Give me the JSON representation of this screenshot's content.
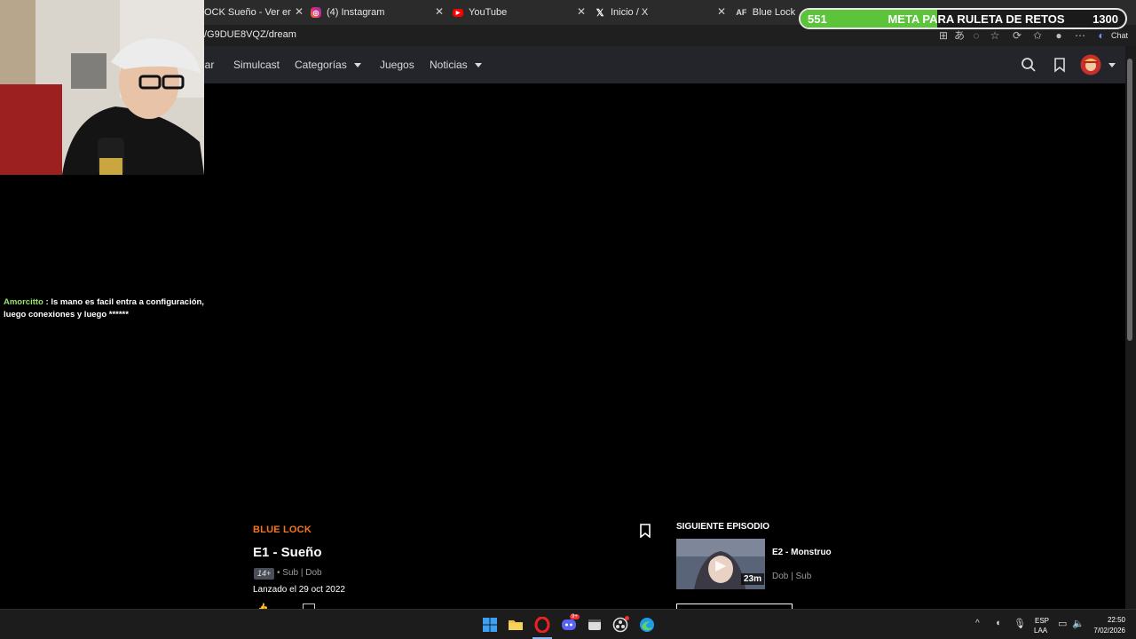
{
  "browser": {
    "tabs": [
      {
        "label": "OCK Sueño - Ver en Crunch",
        "icon": "crunchyroll-icon"
      },
      {
        "label": "(4) Instagram",
        "icon": "instagram-icon"
      },
      {
        "label": "YouTube",
        "icon": "youtube-icon"
      },
      {
        "label": "Inicio / X",
        "icon": "x-icon"
      },
      {
        "label": "Blue Lock Episo",
        "icon": "animeflv-icon"
      }
    ],
    "url": "/G9DUE8VQZ/dream",
    "chat_label": "Chat"
  },
  "goal": {
    "start": "551",
    "title": "META PARA RULETA DE RETOS",
    "end": "1300",
    "progress": 0.42,
    "fill_color": "#5bc43a"
  },
  "site_nav": {
    "items": [
      "lar",
      "Simulcast",
      "Categorías",
      "Juegos",
      "Noticias"
    ]
  },
  "chat": {
    "user": "Amorcitto",
    "message": ": ls mano es facil entra a configuración, luego conexiones y luego ******"
  },
  "episode": {
    "series": "BLUE LOCK",
    "title": "E1 - Sueño",
    "rating": "14+",
    "audio": "• Sub | Dob",
    "released": "Lanzado el 29 oct 2022"
  },
  "next_episode": {
    "label": "SIGUIENTE EPISODIO",
    "title": "E2 - Monstruo",
    "duration": "23m",
    "audio": "Dob | Sub"
  },
  "taskbar": {
    "lang_line1": "ESP",
    "lang_line2": "LAA",
    "time": "22:50",
    "date": "7/02/2026",
    "discord_badge": "9+"
  },
  "colors": {
    "accent": "#f47521",
    "header_bg": "#23252b",
    "chat_user": "#9be36b"
  }
}
